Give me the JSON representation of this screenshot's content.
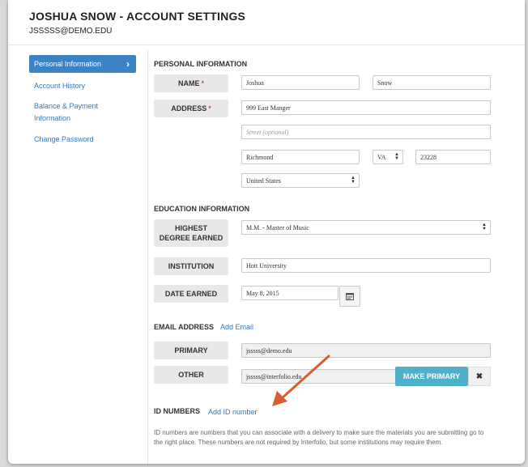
{
  "header": {
    "title": "JOSHUA SNOW - ACCOUNT SETTINGS",
    "email": "JSSSSS@DEMO.EDU"
  },
  "sidebar": {
    "items": [
      {
        "label": "Personal Information",
        "active": true
      },
      {
        "label": "Account History"
      },
      {
        "label": "Balance & Payment Information"
      },
      {
        "label": "Change Password"
      }
    ]
  },
  "personal": {
    "section_title": "PERSONAL INFORMATION",
    "name_label": "NAME",
    "first_name": "Joshua",
    "last_name": "Snow",
    "address_label": "ADDRESS",
    "street": "999 East Manger",
    "street2_placeholder": "Street (optional)",
    "city": "Richmond",
    "state": "VA",
    "zip": "23228",
    "country": "United States",
    "required_marker": "*"
  },
  "education": {
    "section_title": "EDUCATION INFORMATION",
    "degree_label": "HIGHEST DEGREE EARNED",
    "degree_value": "M.M. - Master of Music",
    "institution_label": "INSTITUTION",
    "institution_value": "Hott University",
    "date_label": "DATE EARNED",
    "date_value": "May 8, 2015"
  },
  "email": {
    "section_title": "EMAIL ADDRESS",
    "add_link": "Add Email",
    "primary_label": "PRIMARY",
    "primary_value": "jsssss@demo.edu",
    "other_label": "OTHER",
    "other_value": "jsssss@interfolio.edu",
    "make_primary": "MAKE PRIMARY",
    "remove": "✖"
  },
  "ids": {
    "section_title": "ID NUMBERS",
    "add_link": "Add ID number",
    "description": "ID numbers are numbers that you can associate with a delivery to make sure the materials you are submitting go to the right place. These numbers are not required by Interfolio, but some institutions may require them."
  },
  "colors": {
    "accent": "#3b83c4",
    "link": "#3578b5",
    "teal_button": "#4fb0ca",
    "annotation_arrow": "#d65f32"
  }
}
